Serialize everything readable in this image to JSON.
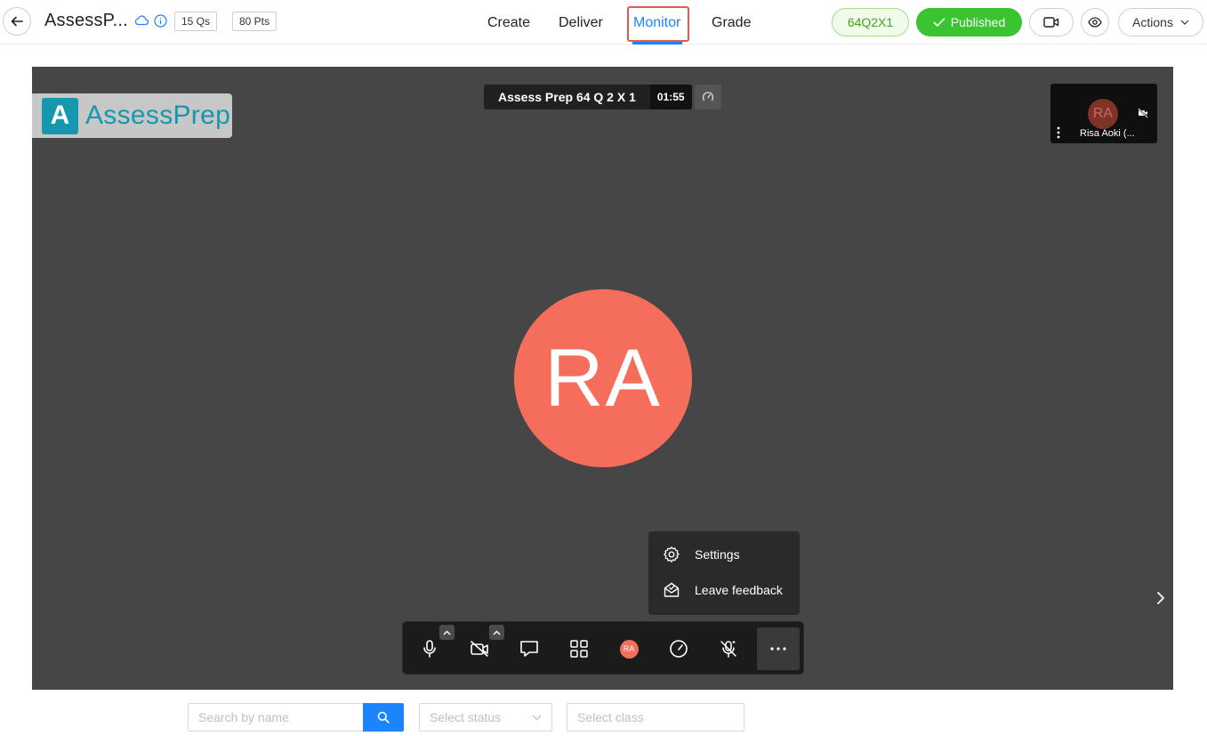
{
  "header": {
    "back_icon": "arrow-left-icon",
    "title": "AssessP...",
    "cloud_icon": "cloud-icon",
    "info_icon": "info-icon",
    "questions_chip": "15 Qs",
    "points_chip": "80 Pts"
  },
  "nav": {
    "tabs": [
      {
        "label": "Create"
      },
      {
        "label": "Deliver"
      },
      {
        "label": "Monitor",
        "active": true
      },
      {
        "label": "Grade"
      }
    ],
    "active_color": "#1b84ff"
  },
  "actions": {
    "code": "64Q2X1",
    "published_label": "Published",
    "published_color": "#3ac430",
    "video_icon": "video-camera-icon",
    "preview_icon": "eye-icon",
    "actions_label": "Actions"
  },
  "meeting": {
    "logo_letter": "A",
    "logo_text": "AssessPrep",
    "title": "Assess Prep 64 Q 2 X 1",
    "timer": "01:55",
    "participant_initials": "RA",
    "participant_thumb_name": "Risa Aoki (...",
    "avatar_color": "#f56d5b",
    "more_menu": {
      "settings_label": "Settings",
      "feedback_label": "Leave feedback"
    },
    "toolbar": {
      "mic_icon": "microphone-icon",
      "camera_icon": "camera-off-icon",
      "chat_icon": "chat-icon",
      "grid_icon": "grid-view-icon",
      "avatar_initials": "RA",
      "speed_icon": "gauge-icon",
      "noise_icon": "mic-off-sparkle-icon",
      "more_icon": "more-horizontal-icon"
    }
  },
  "filters": {
    "search_placeholder": "Search by name",
    "status_placeholder": "Select status",
    "class_placeholder": "Select class"
  }
}
